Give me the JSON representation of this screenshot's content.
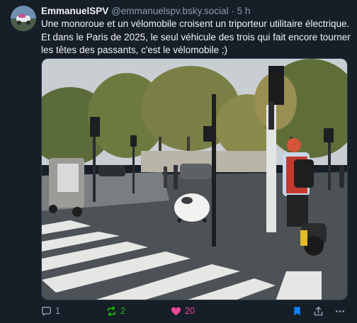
{
  "post": {
    "author_name": "EmmanuelSPV",
    "author_handle": "@emmanuelspv.bsky.social",
    "separator": "·",
    "timestamp": "5 h",
    "text": "Une monoroue et un vélomobile croisent un triporteur utilitaire électrique. Et dans le Paris de 2025, le seul véhicule des trois qui fait encore tourner les têtes des passants, c'est le vélomobile ;)",
    "counts": {
      "replies": "1",
      "reposts": "2",
      "likes": "20"
    }
  },
  "colors": {
    "background": "#161e27",
    "text": "#f1f3f5",
    "muted": "#8c9bb0",
    "repost_active": "#20bc07",
    "like_active": "#ec4899",
    "bookmark_active": "#1083fe"
  },
  "icons": {
    "reply": "speech-bubble-icon",
    "repost": "repost-arrows-icon",
    "like": "heart-icon",
    "bookmark": "bookmark-icon",
    "share": "share-upload-icon",
    "more": "ellipsis-icon"
  }
}
